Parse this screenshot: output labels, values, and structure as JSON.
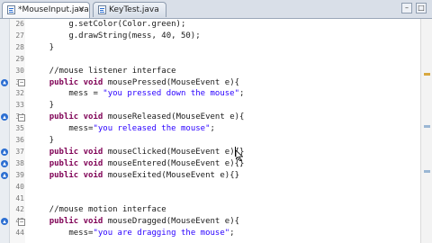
{
  "tabs": [
    {
      "label": "*MouseInput.java",
      "close": "✕",
      "active": true,
      "icon": "java-file-icon"
    },
    {
      "label": "KeyTest.java",
      "close": "",
      "active": false,
      "icon": "java-file-icon"
    }
  ],
  "window_buttons": {
    "minimize": "–",
    "maximize": "□"
  },
  "editor": {
    "lines": [
      {
        "num": "26",
        "code": "        g.setColor(Color.green);"
      },
      {
        "num": "27",
        "code": "        g.drawString(mess, 40, 50);"
      },
      {
        "num": "28",
        "code": "    }"
      },
      {
        "num": "29",
        "code": ""
      },
      {
        "num": "30",
        "code": "    //mouse listener interface"
      },
      {
        "num": "31",
        "code": "    public void mousePressed(MouseEvent e){"
      },
      {
        "num": "32",
        "code": "        mess = \"you pressed down the mouse\";"
      },
      {
        "num": "33",
        "code": "    }"
      },
      {
        "num": "34",
        "code": "    public void mouseReleased(MouseEvent e){"
      },
      {
        "num": "35",
        "code": "        mess=\"you released the mouse\";"
      },
      {
        "num": "36",
        "code": "    }"
      },
      {
        "num": "37",
        "code": "    public void mouseClicked(MouseEvent e){}"
      },
      {
        "num": "38",
        "code": "    public void mouseEntered(MouseEvent e){}"
      },
      {
        "num": "39",
        "code": "    public void mouseExited(MouseEvent e){}"
      },
      {
        "num": "40",
        "code": ""
      },
      {
        "num": "41",
        "code": ""
      },
      {
        "num": "42",
        "code": "    //mouse motion interface"
      },
      {
        "num": "43",
        "code": "    public void mouseDragged(MouseEvent e){"
      },
      {
        "num": "44",
        "code": "        mess=\"you are dragging the mouse\";"
      }
    ]
  }
}
